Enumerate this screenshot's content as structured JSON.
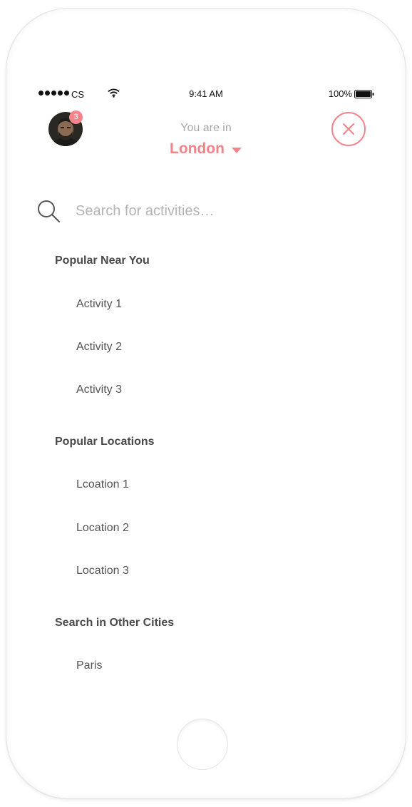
{
  "status_bar": {
    "carrier": "CS",
    "time": "9:41 AM",
    "battery": "100%",
    "icons": [
      "signal-dots-icon",
      "wifi-icon",
      "battery-icon"
    ]
  },
  "header": {
    "notification_count": "3",
    "location_prompt": "You are in",
    "location": "London",
    "icons": [
      "avatar",
      "caret-down-icon",
      "close-icon"
    ]
  },
  "search": {
    "placeholder": "Search for activities…",
    "value": ""
  },
  "sections": {
    "popular_near_you": {
      "title": "Popular Near You",
      "items": [
        "Activity 1",
        "Activity 2",
        "Activity 3"
      ]
    },
    "popular_locations": {
      "title": "Popular Locations",
      "items": [
        "Lcoation 1",
        "Location 2",
        "Location 3"
      ]
    },
    "other_cities": {
      "title": "Search in Other Cities",
      "items": [
        "Paris"
      ]
    }
  },
  "colors": {
    "accent": "#f4838a",
    "muted_text": "#a8a8a8",
    "heading_text": "#4a4a4a"
  }
}
